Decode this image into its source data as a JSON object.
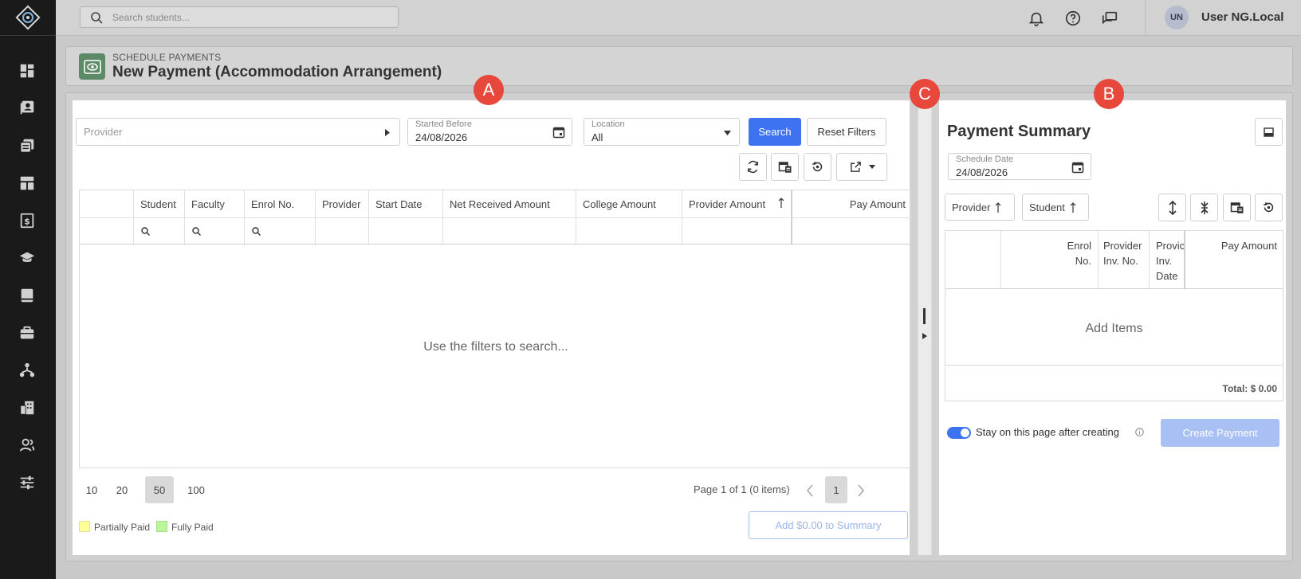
{
  "topbar": {
    "search_placeholder": "Search students...",
    "user_initials": "UN",
    "user_name": "User NG.Local"
  },
  "header": {
    "subtitle": "SCHEDULE PAYMENTS",
    "title": "New Payment (Accommodation Arrangement)"
  },
  "filters": {
    "provider_placeholder": "Provider",
    "started_before_label": "Started Before",
    "started_before_value": "24/08/2026",
    "location_label": "Location",
    "location_value": "All",
    "search_label": "Search",
    "reset_label": "Reset Filters"
  },
  "grid": {
    "columns": [
      "Student",
      "Faculty",
      "Enrol No.",
      "Provider",
      "Start Date",
      "Net Received Amount",
      "College Amount",
      "Provider Amount",
      "Pay Amount"
    ],
    "empty_message": "Use the filters to search..."
  },
  "pagination": {
    "sizes": [
      "10",
      "20",
      "50",
      "100"
    ],
    "selected_size": "50",
    "page_info": "Page 1 of 1 (0 items)",
    "current_page": "1"
  },
  "legend": {
    "partial": "Partially Paid",
    "full": "Fully Paid",
    "partial_color": "#ffff99",
    "full_color": "#b9f79a"
  },
  "add_summary_label": "Add $0.00 to Summary",
  "summary": {
    "title": "Payment Summary",
    "schedule_date_label": "Schedule Date",
    "schedule_date_value": "24/08/2026",
    "sort_provider": "Provider",
    "sort_student": "Student",
    "columns": {
      "enrol": "Enrol No.",
      "provider_inv_no": "Provider Inv. No.",
      "provider_inv_date": "Provic Inv. Date",
      "pay_amount": "Pay Amount"
    },
    "empty_message": "Add Items",
    "total": "Total: $ 0.00",
    "stay_label": "Stay on this page after creating",
    "create_label": "Create Payment"
  },
  "markers": {
    "a": "A",
    "b": "B",
    "c": "C"
  },
  "colors": {
    "accent": "#3d73f0",
    "marker": "#e8473b",
    "sidebar": "#1a1a1a"
  }
}
